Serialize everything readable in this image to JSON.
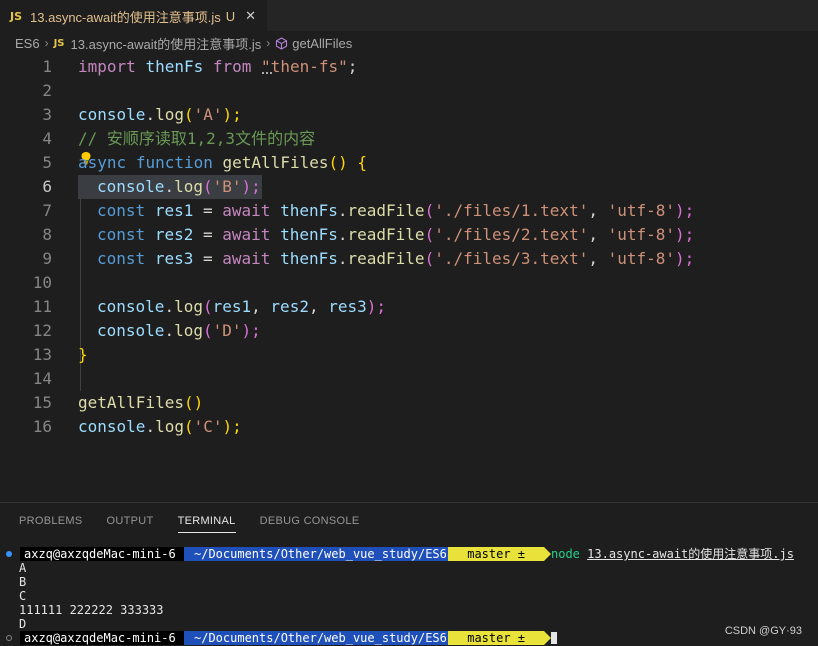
{
  "tab": {
    "badge": "JS",
    "title": "13.async-await的使用注意事项.js",
    "status": "U",
    "close": "✕"
  },
  "breadcrumb": {
    "root": "ES6",
    "sep": "›",
    "badge": "JS",
    "file": "13.async-await的使用注意事项.js",
    "symbol": "getAllFiles"
  },
  "editor": {
    "active_line": 6,
    "lines": [
      {
        "n": "1"
      },
      {
        "n": "2"
      },
      {
        "n": "3"
      },
      {
        "n": "4"
      },
      {
        "n": "5"
      },
      {
        "n": "6"
      },
      {
        "n": "7"
      },
      {
        "n": "8"
      },
      {
        "n": "9"
      },
      {
        "n": "10"
      },
      {
        "n": "11"
      },
      {
        "n": "12"
      },
      {
        "n": "13"
      },
      {
        "n": "14"
      },
      {
        "n": "15"
      },
      {
        "n": "16"
      }
    ],
    "code": {
      "l1": [
        "import",
        " ",
        "thenFs",
        " ",
        "from",
        " ",
        "\"then-fs\"",
        ";"
      ],
      "l3": [
        "console",
        ".",
        "log",
        "(",
        "'A'",
        ");"
      ],
      "l4": "// 安顺序读取1,2,3文件的内容",
      "l5": [
        "async",
        " ",
        "function",
        " ",
        "getAllFiles",
        "()",
        " ",
        "{"
      ],
      "l6": [
        "console",
        ".",
        "log",
        "(",
        "'B'",
        ");"
      ],
      "l7": [
        "const",
        " ",
        "res1",
        " = ",
        "await",
        " ",
        "thenFs",
        ".",
        "readFile",
        "(",
        "'./files/1.text'",
        ", ",
        "'utf-8'",
        ");"
      ],
      "l8": [
        "const",
        " ",
        "res2",
        " = ",
        "await",
        " ",
        "thenFs",
        ".",
        "readFile",
        "(",
        "'./files/2.text'",
        ", ",
        "'utf-8'",
        ");"
      ],
      "l9": [
        "const",
        " ",
        "res3",
        " = ",
        "await",
        " ",
        "thenFs",
        ".",
        "readFile",
        "(",
        "'./files/3.text'",
        ", ",
        "'utf-8'",
        ");"
      ],
      "l11": [
        "console",
        ".",
        "log",
        "(",
        "res1",
        ", ",
        "res2",
        ", ",
        "res3",
        ");"
      ],
      "l12": [
        "console",
        ".",
        "log",
        "(",
        "'D'",
        ");"
      ],
      "l13": "}",
      "l15": [
        "getAllFiles",
        "()"
      ],
      "l16": [
        "console",
        ".",
        "log",
        "(",
        "'C'",
        ");"
      ]
    }
  },
  "panel": {
    "tabs": [
      "PROBLEMS",
      "OUTPUT",
      "TERMINAL",
      "DEBUG CONSOLE"
    ],
    "active_tab": "TERMINAL"
  },
  "terminal": {
    "user": "axzq@axzqdeMac-mini-6",
    "path": "~/Documents/Other/web_vue_study/ES6",
    "git": " master ±",
    "cmd_node": "node",
    "cmd_file": "13.async-await的使用注意事项.js",
    "output": [
      "A",
      "B",
      "C",
      "111111 222222 333333",
      "D"
    ]
  },
  "watermark": "CSDN @GY·93",
  "colors": {
    "editor_bg": "#1e1e1e",
    "tab_modified": "#e2c08d",
    "path_segment": "#1f4fb8",
    "git_segment": "#e8e23a",
    "node_green": "#23d18b"
  }
}
